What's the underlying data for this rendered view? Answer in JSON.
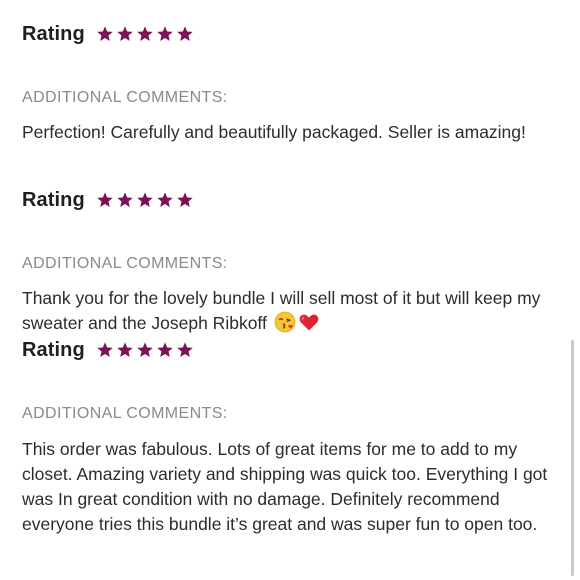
{
  "reviews": [
    {
      "rating_label": "Rating",
      "stars": 5,
      "comments_heading": "ADDITIONAL COMMENTS:",
      "comment": "Perfection! Carefully and beautifully packaged. Seller is amazing!"
    },
    {
      "rating_label": "Rating",
      "stars": 5,
      "comments_heading": "ADDITIONAL COMMENTS:",
      "comment": "Thank you for the lovely bundle I will sell most of it but will keep my sweater and the Joseph Ribkoff",
      "emojis": [
        "kissing-face-emoji",
        "red-heart-emoji"
      ]
    },
    {
      "rating_label": "Rating",
      "stars": 5,
      "comments_heading": "ADDITIONAL COMMENTS:",
      "comment": "This order was fabulous. Lots of great items for me to add to my closet. Amazing variety and shipping was quick too. Everything I got was In great condition with no damage. Definitely recommend everyone tries this bundle it’s great and was super fun to open too."
    }
  ],
  "colors": {
    "star": "#7b1456",
    "heading": "#8a8a8a",
    "text": "#2c2c2c"
  },
  "icons": {
    "star": "star-icon"
  }
}
